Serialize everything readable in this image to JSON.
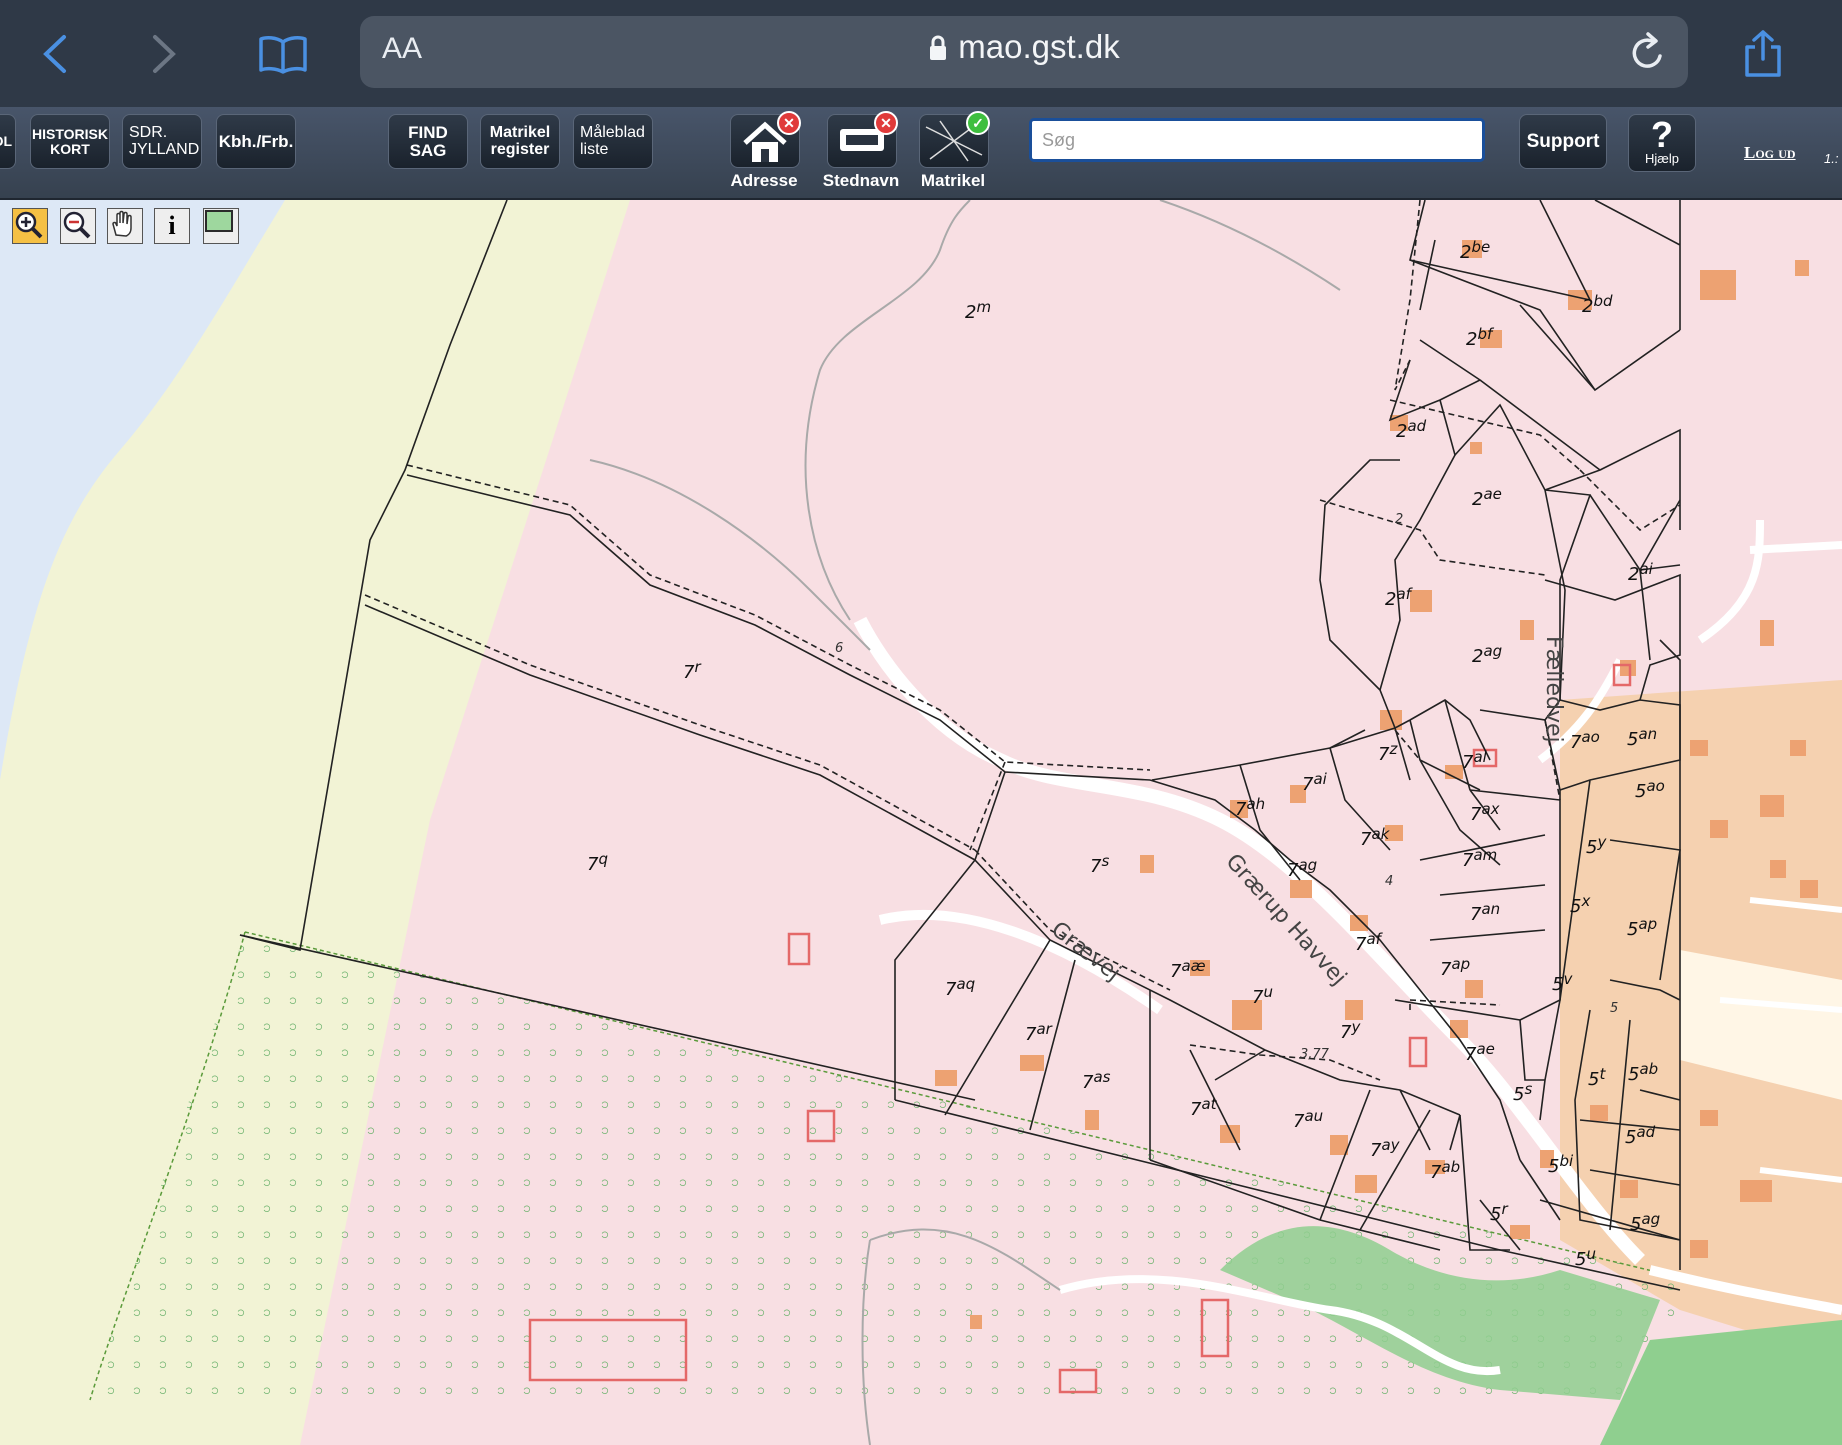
{
  "browser": {
    "url": "mao.gst.dk",
    "text_size_label": "AA"
  },
  "toolbar": {
    "buttons": [
      {
        "label": "DL"
      },
      {
        "label": "HISTORISK\nKORT"
      },
      {
        "label": "SDR.\nJYLLAND"
      },
      {
        "label": "Kbh./Frb."
      },
      {
        "label": "FIND\nSAG"
      },
      {
        "label": "Matrikel\nregister"
      },
      {
        "label": "Måleblad\nliste"
      }
    ],
    "layers": [
      {
        "label": "Adresse",
        "status": "off",
        "badge": "✕",
        "badge_color": "#e03a3a"
      },
      {
        "label": "Stednavn",
        "status": "off",
        "badge": "✕",
        "badge_color": "#e03a3a"
      },
      {
        "label": "Matrikel",
        "status": "on",
        "badge": "✓",
        "badge_color": "#3fbf3f"
      }
    ],
    "search_placeholder": "Søg",
    "support_label": "Support",
    "help_label": "Hjælp",
    "help_symbol": "?",
    "logout_label": "Log ud",
    "scale_text": "1.:"
  },
  "map_tools": [
    "zoom-in",
    "zoom-out",
    "pan",
    "info",
    "extent"
  ],
  "map": {
    "roads": [
      "Grærup Havvej",
      "Grævej",
      "Fælledvej"
    ],
    "parcels": [
      {
        "num": "2",
        "sub": "m"
      },
      {
        "num": "2",
        "sub": "be"
      },
      {
        "num": "2",
        "sub": "bd"
      },
      {
        "num": "2",
        "sub": "bf"
      },
      {
        "num": "2",
        "sub": "ad"
      },
      {
        "num": "2",
        "sub": "ae"
      },
      {
        "num": "2",
        "sub": "ai"
      },
      {
        "num": "2",
        "sub": "af"
      },
      {
        "num": "2",
        "sub": "ag"
      },
      {
        "num": "7",
        "sub": "r"
      },
      {
        "num": "7",
        "sub": "q"
      },
      {
        "num": "7",
        "sub": "s"
      },
      {
        "num": "7",
        "sub": "z"
      },
      {
        "num": "7",
        "sub": "ai"
      },
      {
        "num": "7",
        "sub": "ah"
      },
      {
        "num": "7",
        "sub": "al"
      },
      {
        "num": "7",
        "sub": "ax"
      },
      {
        "num": "7",
        "sub": "ak"
      },
      {
        "num": "7",
        "sub": "ag"
      },
      {
        "num": "7",
        "sub": "am"
      },
      {
        "num": "7",
        "sub": "an"
      },
      {
        "num": "7",
        "sub": "af"
      },
      {
        "num": "7",
        "sub": "ap"
      },
      {
        "num": "7",
        "sub": "aæ"
      },
      {
        "num": "7",
        "sub": "u"
      },
      {
        "num": "7",
        "sub": "aq"
      },
      {
        "num": "7",
        "sub": "ar"
      },
      {
        "num": "7",
        "sub": "as"
      },
      {
        "num": "7",
        "sub": "y"
      },
      {
        "num": "7",
        "sub": "ae"
      },
      {
        "num": "7",
        "sub": "at"
      },
      {
        "num": "7",
        "sub": "au"
      },
      {
        "num": "7",
        "sub": "ay"
      },
      {
        "num": "7",
        "sub": "ab"
      },
      {
        "num": "7",
        "sub": "ao"
      },
      {
        "num": "5",
        "sub": "an"
      },
      {
        "num": "5",
        "sub": "ao"
      },
      {
        "num": "5",
        "sub": "y"
      },
      {
        "num": "5",
        "sub": "x"
      },
      {
        "num": "5",
        "sub": "ap"
      },
      {
        "num": "5",
        "sub": "v"
      },
      {
        "num": "5",
        "sub": "s"
      },
      {
        "num": "5",
        "sub": "t"
      },
      {
        "num": "5",
        "sub": "ab"
      },
      {
        "num": "5",
        "sub": "ad"
      },
      {
        "num": "5",
        "sub": "bi"
      },
      {
        "num": "5",
        "sub": "ag"
      },
      {
        "num": "5",
        "sub": "r"
      },
      {
        "num": "5",
        "sub": "u"
      }
    ],
    "edge_marks": [
      "6",
      "2",
      "4",
      "5",
      "3,77"
    ]
  },
  "colors": {
    "chrome_bg": "#2f3947",
    "toolbar_bg": "#3f4a5b",
    "map_pink": "#f8dfe3",
    "sea": "#dde8f6",
    "dune": "#f2f3d5",
    "forest_green": "#8fcf8f",
    "urban": "#f5d1b0",
    "building": "#eda272",
    "accent_blue": "#4a90e2"
  }
}
